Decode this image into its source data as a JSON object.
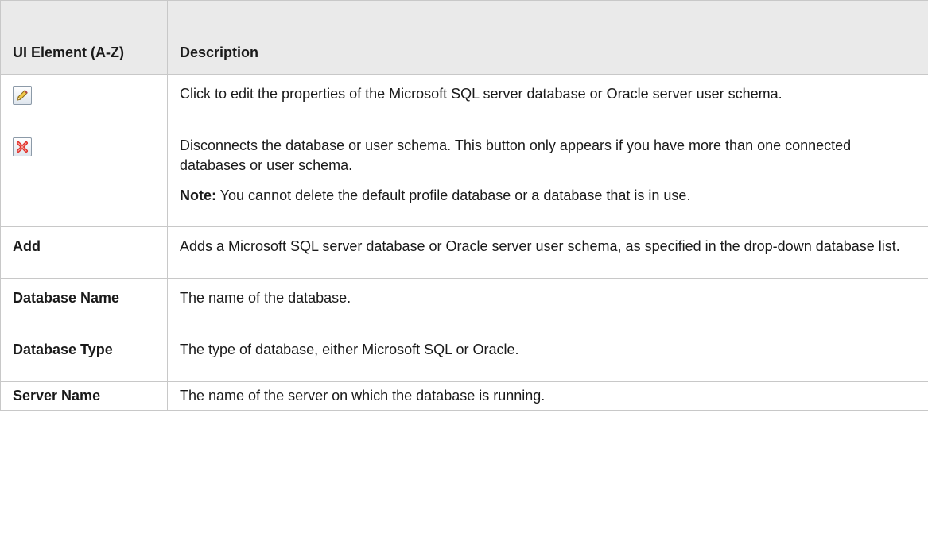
{
  "table": {
    "header": {
      "col1": "UI Element (A-Z)",
      "col2": "Description"
    },
    "rows": [
      {
        "element_icon": "pencil-edit-icon",
        "description": "Click to edit the properties of the Microsoft SQL server database or Oracle server user schema."
      },
      {
        "element_icon": "red-x-delete-icon",
        "description": "Disconnects the database or user schema. This button only appears if you have more than one connected databases or user schema.",
        "note_label": "Note:",
        "note_text": " You cannot delete the default profile database or a database that is in use."
      },
      {
        "element": "Add",
        "description": "Adds a Microsoft SQL server database or Oracle server user schema, as specified in the drop-down database list."
      },
      {
        "element": "Database Name",
        "description": "The name of the database."
      },
      {
        "element": "Database Type",
        "description": "The type of database, either Microsoft SQL or Oracle."
      },
      {
        "element": "Server Name",
        "description": "The name of the server on which the database is running."
      }
    ]
  },
  "colors": {
    "header_bg": "#eaeaea",
    "border": "#c8c8c8",
    "delete_red": "#e0302a",
    "pencil_yellow": "#f2c94c"
  }
}
